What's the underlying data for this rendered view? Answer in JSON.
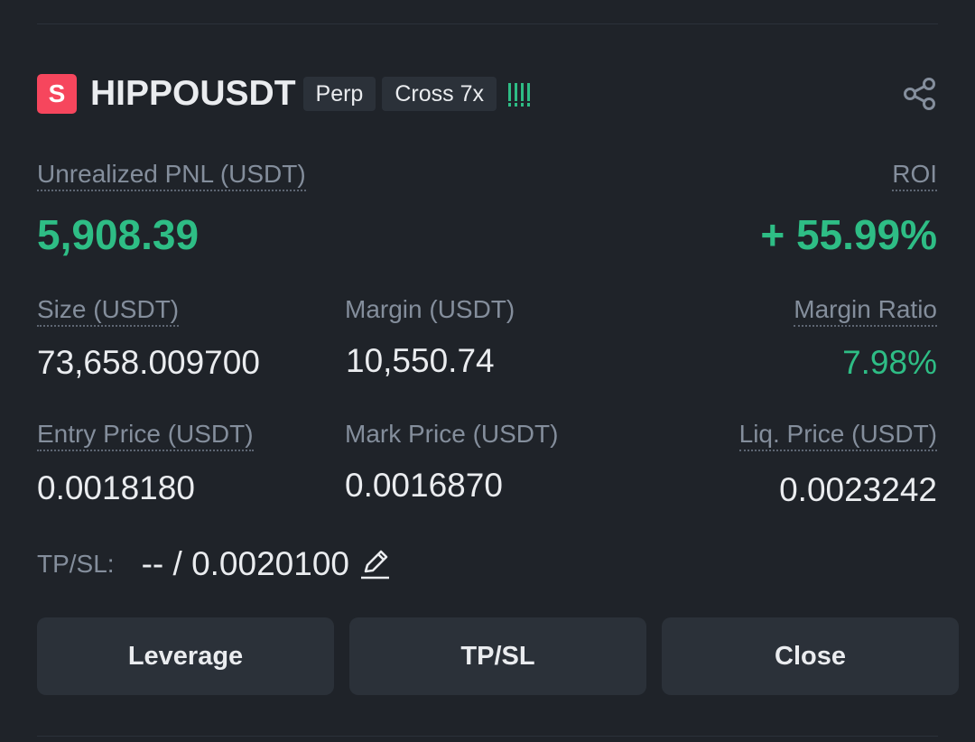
{
  "position": {
    "side_letter": "S",
    "symbol": "HIPPOUSDT",
    "contract_type": "Perp",
    "margin_mode": "Cross 7x",
    "leverage_bars": 4
  },
  "pnl": {
    "label": "Unrealized PNL (USDT)",
    "value": "5,908.39"
  },
  "roi": {
    "label": "ROI",
    "value": "+ 55.99%"
  },
  "size": {
    "label": "Size (USDT)",
    "value": "73,658.009700"
  },
  "margin": {
    "label": "Margin (USDT)",
    "value": "10,550.74"
  },
  "margin_ratio": {
    "label": "Margin Ratio",
    "value": "7.98%"
  },
  "entry_price": {
    "label": "Entry Price (USDT)",
    "value": "0.0018180"
  },
  "mark_price": {
    "label": "Mark Price (USDT)",
    "value": "0.0016870"
  },
  "liq_price": {
    "label": "Liq. Price (USDT)",
    "value": "0.0023242"
  },
  "tpsl": {
    "label": "TP/SL:",
    "value": "-- / 0.0020100"
  },
  "actions": {
    "leverage_label": "Leverage",
    "tpsl_label": "TP/SL",
    "close_label": "Close"
  },
  "colors": {
    "background": "#1f2329",
    "profit_green": "#2ebd85",
    "short_red": "#f6465d",
    "tag_bg": "#2b3139",
    "muted_text": "#848e9c",
    "primary_text": "#eaecef"
  },
  "icons": {
    "share": "share-icon",
    "edit": "edit-icon"
  }
}
